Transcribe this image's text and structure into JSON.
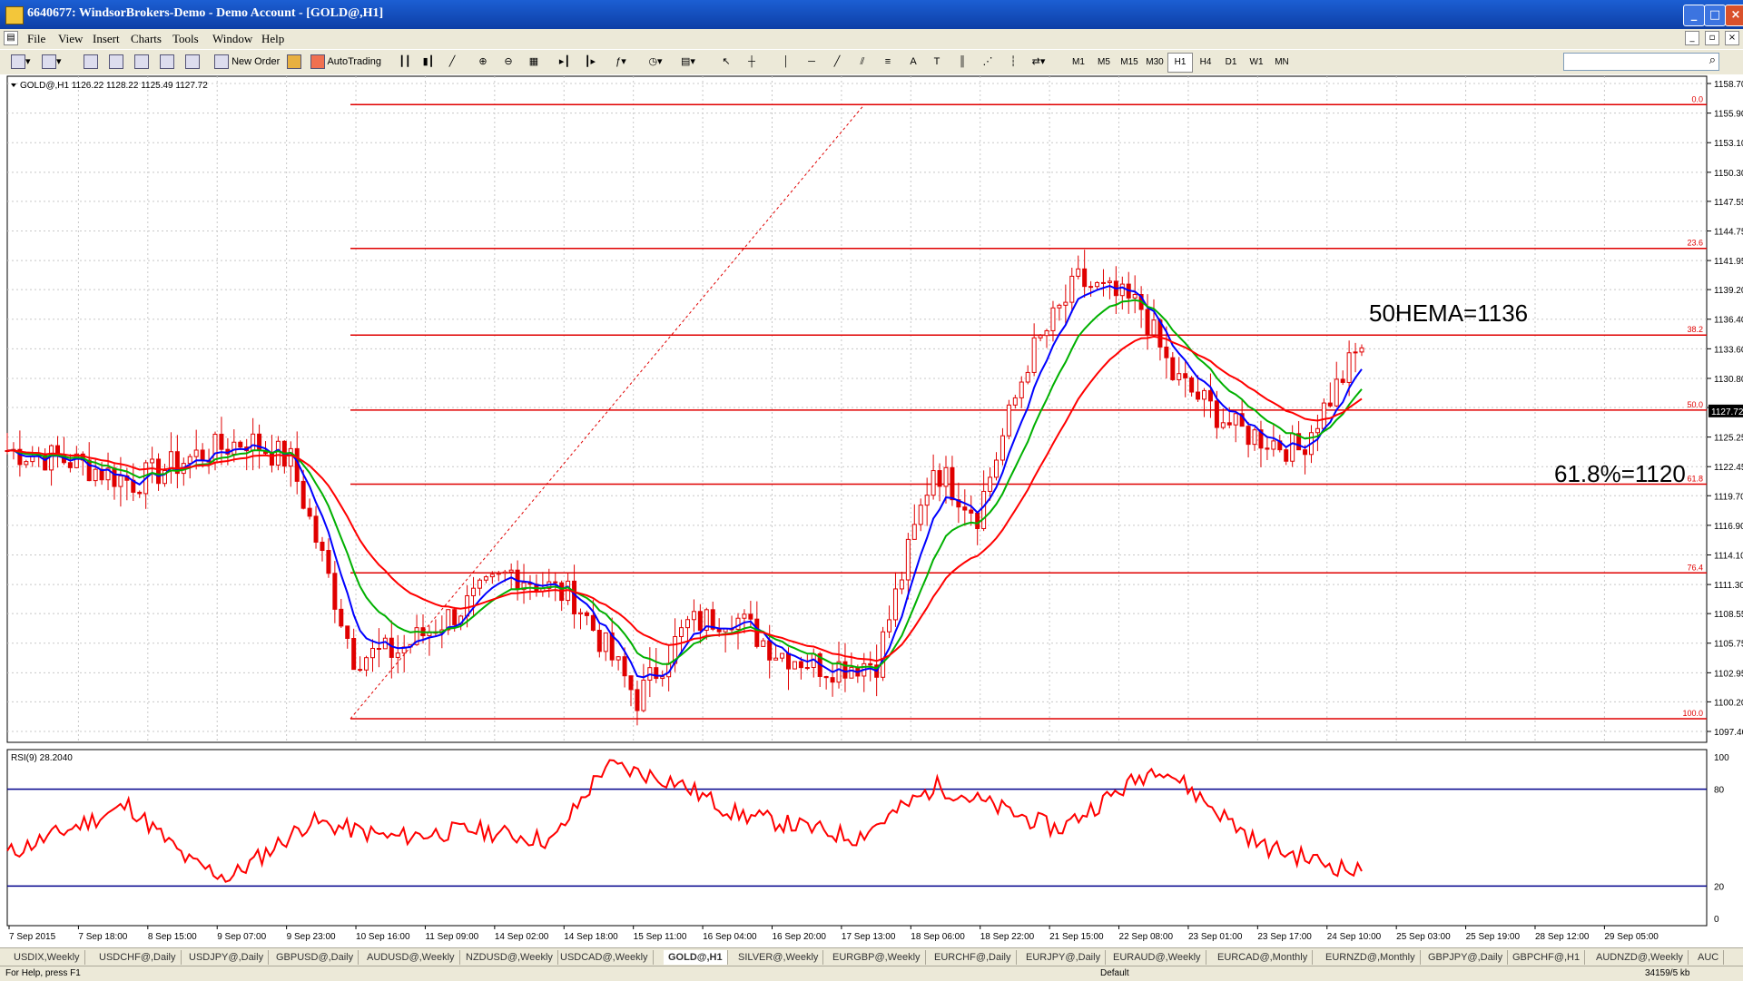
{
  "window": {
    "title": "6640677: WindsorBrokers-Demo - Demo Account - [GOLD@,H1]"
  },
  "menu": [
    "File",
    "View",
    "Insert",
    "Charts",
    "Tools",
    "Window",
    "Help"
  ],
  "toolbar": {
    "new_order": "New Order",
    "autotrading": "AutoTrading",
    "timeframes": [
      "M1",
      "M5",
      "M15",
      "M30",
      "H1",
      "H4",
      "D1",
      "W1",
      "MN"
    ],
    "active_timeframe": "H1"
  },
  "chart": {
    "header": "GOLD@,H1  1126.22 1128.22 1125.49 1127.72",
    "price_axis": [
      "1158.70",
      "1155.90",
      "1153.10",
      "1150.30",
      "1147.55",
      "1144.75",
      "1141.95",
      "1139.20",
      "1136.40",
      "1133.60",
      "1130.80",
      "1128.05",
      "1125.25",
      "1122.45",
      "1119.70",
      "1116.90",
      "1114.10",
      "1111.30",
      "1108.55",
      "1105.75",
      "1102.95",
      "1100.20",
      "1097.40"
    ],
    "current_price": "1127.72",
    "fib_levels": [
      {
        "label": "0.0",
        "price": 1156.7
      },
      {
        "label": "23.6",
        "price": 1143.1
      },
      {
        "label": "38.2",
        "price": 1134.9
      },
      {
        "label": "50.0",
        "price": 1127.8
      },
      {
        "label": "61.8",
        "price": 1120.8
      },
      {
        "label": "76.4",
        "price": 1112.4
      },
      {
        "label": "100.0",
        "price": 1098.6
      }
    ],
    "annotations": [
      "50HEMA=1136",
      "61.8%=1120"
    ],
    "time_axis": [
      "7 Sep 2015",
      "7 Sep 18:00",
      "8 Sep 15:00",
      "9 Sep 07:00",
      "9 Sep 23:00",
      "10 Sep 16:00",
      "11 Sep 09:00",
      "14 Sep 02:00",
      "14 Sep 18:00",
      "15 Sep 11:00",
      "16 Sep 04:00",
      "16 Sep 20:00",
      "17 Sep 13:00",
      "18 Sep 06:00",
      "18 Sep 22:00",
      "21 Sep 15:00",
      "22 Sep 08:00",
      "23 Sep 01:00",
      "23 Sep 17:00",
      "24 Sep 10:00",
      "25 Sep 03:00",
      "25 Sep 19:00",
      "28 Sep 12:00",
      "29 Sep 05:00"
    ],
    "rsi_header": "RSI(9) 28.2040",
    "rsi_axis": [
      "100",
      "80",
      "20",
      "0"
    ],
    "colors": {
      "fib": "#e00000",
      "fast_ma": "#0000ff",
      "mid_ma": "#00b000",
      "slow_ma": "#ff0000",
      "candles": "#e00000",
      "rsi": "#ff0000",
      "rsi_levels": "#00008b"
    }
  },
  "chart_data": {
    "type": "line",
    "series": [
      {
        "name": "Price (close)",
        "x": [
          0,
          10,
          20,
          30,
          38,
          45,
          55,
          62,
          72,
          80,
          90,
          100,
          108,
          115,
          122,
          130,
          138,
          147,
          154,
          162,
          170,
          180,
          185,
          195,
          205,
          215
        ],
        "values": [
          1124.0,
          1123.0,
          1121.0,
          1123.5,
          1125.0,
          1123.0,
          1104.5,
          1105.0,
          1109.0,
          1112.5,
          1110.0,
          1100.5,
          1107.5,
          1108.5,
          1105.0,
          1103.5,
          1104.0,
          1122.5,
          1118.0,
          1132.5,
          1140.0,
          1137.5,
          1131.0,
          1126.0,
          1124.0,
          1134.0
        ]
      },
      {
        "name": "RSI",
        "x": [
          0,
          30,
          45,
          55,
          75,
          95,
          115,
          135,
          148,
          165,
          180,
          210,
          230,
          260,
          285,
          310,
          335
        ],
        "values": [
          40,
          70,
          35,
          25,
          60,
          50,
          55,
          48,
          95,
          85,
          65,
          50,
          82,
          55,
          95,
          45,
          28
        ]
      }
    ]
  },
  "tabs": [
    "USDIX,Weekly",
    "USDCHF@,Daily",
    "USDJPY@,Daily",
    "GBPUSD@,Daily",
    "AUDUSD@,Weekly",
    "NZDUSD@,Weekly",
    "USDCAD@,Weekly",
    "GOLD@,H1",
    "SILVER@,Weekly",
    "EURGBP@,Weekly",
    "EURCHF@,Daily",
    "EURJPY@,Daily",
    "EURAUD@,Weekly",
    "EURCAD@,Monthly",
    "EURNZD@,Monthly",
    "GBPJPY@,Daily",
    "GBPCHF@,H1",
    "AUDNZD@,Weekly",
    "AUC"
  ],
  "status": {
    "help": "For Help, press F1",
    "profile": "Default",
    "traffic": "34159/5 kb"
  }
}
